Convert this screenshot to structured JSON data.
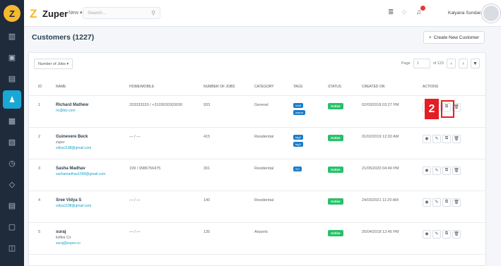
{
  "brand": {
    "name": "Zuper",
    "logo_icon": "zuper-logo-icon"
  },
  "topbar": {
    "new_label": "New ▾",
    "search_placeholder": "Search...",
    "user_name": "Kalyana Sundaram S ▾"
  },
  "sidebar": {
    "items": [
      {
        "name": "dashboard-icon",
        "glyph": "▥"
      },
      {
        "name": "calendar-icon",
        "glyph": "▣"
      },
      {
        "name": "jobs-icon",
        "glyph": "▤"
      },
      {
        "name": "customers-icon",
        "glyph": "♟",
        "active": true
      },
      {
        "name": "invoice-icon",
        "glyph": "▦"
      },
      {
        "name": "inventory-icon",
        "glyph": "▧"
      },
      {
        "name": "timesheet-icon",
        "glyph": "◷"
      },
      {
        "name": "tags-icon",
        "glyph": "◇"
      },
      {
        "name": "reports-icon",
        "glyph": "▤"
      },
      {
        "name": "assets-icon",
        "glyph": "▢"
      },
      {
        "name": "settings-icon",
        "glyph": "◫"
      }
    ]
  },
  "page": {
    "title": "Customers (1227)",
    "create_button": "Create New Customer",
    "filter_label": "Number of Jobs ▾",
    "pager": {
      "page_label": "Page",
      "page_value": "1",
      "of_label": "of 123"
    }
  },
  "table": {
    "headers": [
      "ID",
      "NAME",
      "HOME/MOBILE",
      "NUMBER OF JOBS",
      "CATEGORY",
      "TAGS",
      "STATUS",
      "CREATED ON",
      "ACTIONS"
    ],
    "rows": [
      {
        "id": "1",
        "name": "Richard Mathew",
        "line2": "",
        "email": "ric@biz.com",
        "phone": "333333333 / +3103030303030",
        "jobs": "933",
        "category": "General",
        "tags": [
          "vivid",
          "wavve"
        ],
        "status": "Active",
        "created": "02/03/2018 03:27 PM"
      },
      {
        "id": "2",
        "name": "Guinevere Beck",
        "line2": "zuper",
        "email": "vidya1198@gmail.com",
        "phone": "— / —",
        "jobs": "415",
        "category": "Residential",
        "tags": [
          "tag2",
          "tag3"
        ],
        "status": "Active",
        "created": "01/02/2019 12:02 AM"
      },
      {
        "id": "3",
        "name": "Sasha Madhav",
        "line2": "",
        "email": "sashamadhav1999@gmail.com",
        "phone": "199 / 9986756475",
        "jobs": "301",
        "category": "Residential",
        "tags": [
          "SO"
        ],
        "status": "Active",
        "created": "21/05/2020 04:49 PM"
      },
      {
        "id": "4",
        "name": "Sree Vidya S",
        "line2": "",
        "email": "vidya1198@gmail.com",
        "phone": "— / —",
        "jobs": "140",
        "category": "Residential",
        "tags": [],
        "status": "Active",
        "created": "24/03/2021 11:20 AM"
      },
      {
        "id": "5",
        "name": "suraj",
        "line2": "koffee Co",
        "email": "suraj@zuper.co",
        "phone": "— / —",
        "jobs": "135",
        "category": "Airports",
        "tags": [],
        "status": "Active",
        "created": "25/04/2018 12:45 PM"
      }
    ]
  },
  "annotation": {
    "label": "2"
  },
  "colors": {
    "accent": "#19a7d6",
    "sidebar": "#1f2a3a",
    "active_status": "#29c06b",
    "tag": "#1c7cc7",
    "annotation": "#e31e24"
  }
}
